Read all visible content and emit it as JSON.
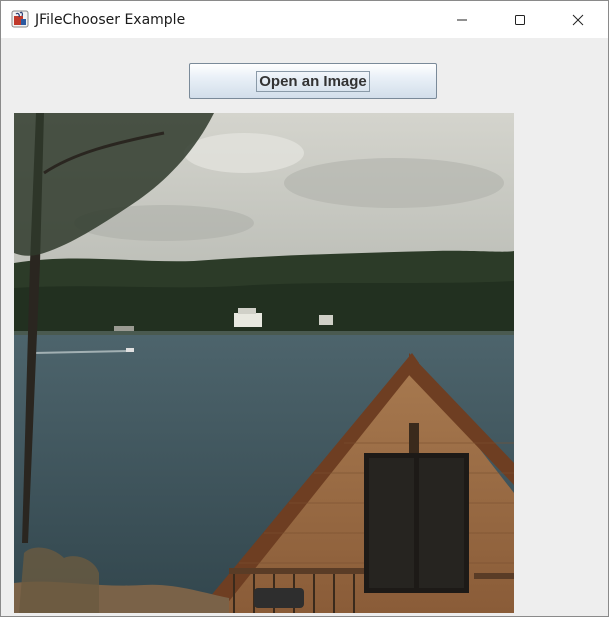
{
  "window": {
    "title": "JFileChooser Example",
    "app_icon": "java-icon",
    "controls": {
      "minimize_icon": "minimize-icon",
      "maximize_icon": "maximize-icon",
      "close_icon": "close-icon"
    }
  },
  "toolbar": {
    "open_image_label": "Open an Image"
  },
  "image": {
    "subject": "lakeside-cabin-photo",
    "colors": {
      "sky": "#c9c9c2",
      "forest": "#2a3a26",
      "lake": "#3e545c",
      "cabin_wood": "#9a6a42",
      "roof": "#7a4a2c"
    }
  }
}
